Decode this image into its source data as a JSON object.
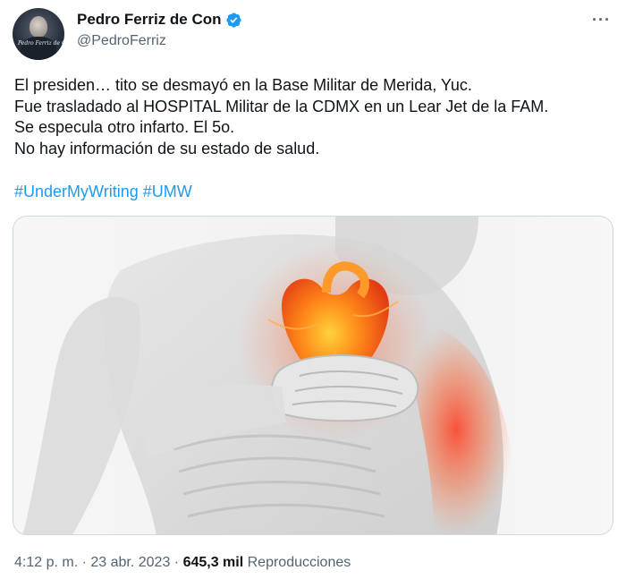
{
  "author": {
    "display_name": "Pedro Ferriz de Con",
    "handle": "@PedroFerriz",
    "avatar_signature": "Pedro Ferriz de Con",
    "verified_color": "#1d9bf0"
  },
  "tweet": {
    "lines": [
      "El presiden… tito se desmayó en la Base Militar de Merida, Yuc.",
      "Fue trasladado al HOSPITAL Militar de la CDMX en un Lear Jet de la FAM.",
      "Se especula otro infarto. El 5o.",
      "No hay información de su estado de salud."
    ],
    "hashtags": [
      "#UnderMyWriting",
      "#UMW"
    ]
  },
  "media": {
    "alt": "Heart attack illustration",
    "accent_color": "#ff5a1f"
  },
  "meta": {
    "time": "4:12 p. m.",
    "separator": " · ",
    "date": "23 abr. 2023",
    "views_count": "645,3 mil",
    "views_label": "Reproducciones"
  },
  "actions": {
    "more_icon": "more-icon"
  }
}
